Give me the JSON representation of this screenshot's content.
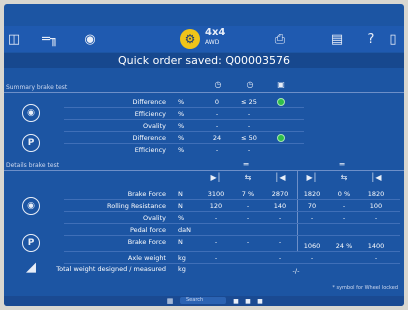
{
  "toolbar": {
    "fourxfour": "4x4",
    "fourxfour_sub": "AWD"
  },
  "title": "Quick order saved: Q00003576",
  "summary": {
    "section_label": "Summary brake test",
    "rows": [
      {
        "label": "Difference",
        "unit": "%",
        "v1": "0",
        "v2": "≤ 25"
      },
      {
        "label": "Efficiency",
        "unit": "%",
        "v1": "-",
        "v2": "-"
      },
      {
        "label": "Ovality",
        "unit": "%",
        "v1": "-",
        "v2": "-"
      },
      {
        "label": "Difference",
        "unit": "%",
        "v1": "24",
        "v2": "≤ 50"
      },
      {
        "label": "Efficiency",
        "unit": "%",
        "v1": "-",
        "v2": "-"
      }
    ]
  },
  "details": {
    "section_label": "Details brake test",
    "rows": [
      {
        "label": "Brake Force",
        "unit": "N",
        "c": [
          "3100",
          "7 %",
          "2870",
          "1820",
          "0 %",
          "1820"
        ]
      },
      {
        "label": "Rolling Resistance",
        "unit": "N",
        "c": [
          "120",
          "-",
          "140",
          "70",
          "-",
          "100"
        ]
      },
      {
        "label": "Ovality",
        "unit": "%",
        "c": [
          "-",
          "-",
          "-",
          "-",
          "-",
          "-"
        ]
      },
      {
        "label": "Pedal force",
        "unit": "daN",
        "c": [
          "",
          "",
          "",
          "",
          "",
          ""
        ]
      },
      {
        "label": "Brake Force",
        "unit": "N",
        "c": [
          "-",
          "-",
          "-",
          "1060",
          "24 %",
          "1400"
        ]
      },
      {
        "label": "Axle weight",
        "unit": "kg",
        "c": [
          "-",
          "",
          "-",
          "-",
          "",
          "-"
        ]
      },
      {
        "label": "Total weight designed / measured",
        "unit": "kg",
        "c": [
          "",
          "",
          "",
          "",
          "",
          ""
        ]
      }
    ],
    "total_marker": "-/-"
  },
  "footnote": "* symbol for Wheel locked",
  "taskbar": {
    "search": "Search"
  }
}
